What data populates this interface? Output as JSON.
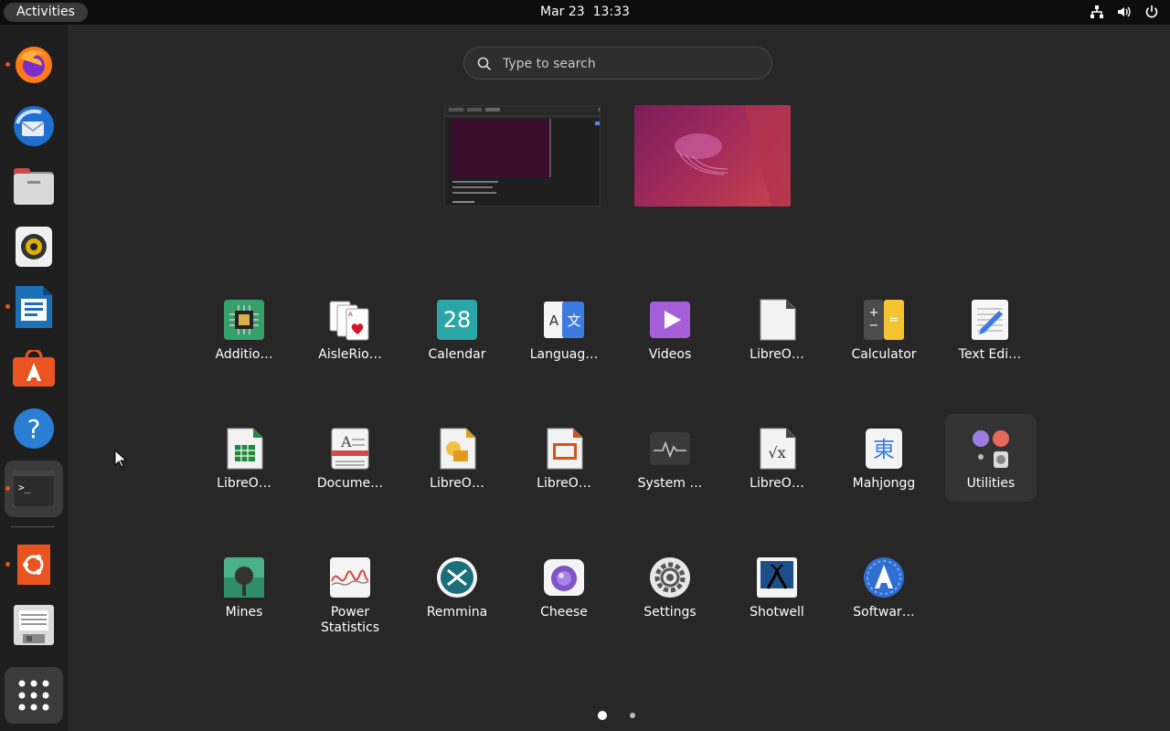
{
  "topbar": {
    "activities": "Activities",
    "date": "Mar 23",
    "time": "13:33"
  },
  "tray": {
    "icons": [
      "network-icon",
      "volume-icon",
      "power-icon"
    ]
  },
  "dock": {
    "items": [
      {
        "name": "firefox",
        "running": true
      },
      {
        "name": "thunderbird",
        "running": false
      },
      {
        "name": "files",
        "running": false
      },
      {
        "name": "rhythmbox",
        "running": false
      },
      {
        "name": "libreoffice-writer",
        "running": true
      },
      {
        "name": "ubuntu-software",
        "running": false
      },
      {
        "name": "help",
        "running": false
      },
      {
        "name": "terminal",
        "running": true,
        "active": true
      },
      {
        "name": "ubuntu",
        "running": true
      },
      {
        "name": "disk-image",
        "running": false
      },
      {
        "name": "show-applications",
        "running": false
      }
    ]
  },
  "search": {
    "placeholder": "Type to search"
  },
  "workspaces": [
    "workspace-1",
    "workspace-2"
  ],
  "apps": {
    "row1": [
      "Additio…",
      "AisleRio…",
      "Calendar",
      "Languag…",
      "Videos",
      "LibreO…",
      "Calculator",
      "Text Edi…"
    ],
    "row2": [
      "LibreO…",
      "Docume…",
      "LibreO…",
      "LibreO…",
      "System …",
      "LibreO…",
      "Mahjongg",
      "Utilities"
    ],
    "row3": [
      "Mines",
      "Power Statistics",
      "Remmina",
      "Cheese",
      "Settings",
      "Shotwell",
      "Softwar…"
    ]
  },
  "calendar_icon_day": "28",
  "pages": {
    "count": 2,
    "current": 1
  },
  "colors": {
    "accent": "#e95420",
    "panel": "#0d0d0d",
    "dock": "#1e1e1e",
    "background": "#272727"
  }
}
